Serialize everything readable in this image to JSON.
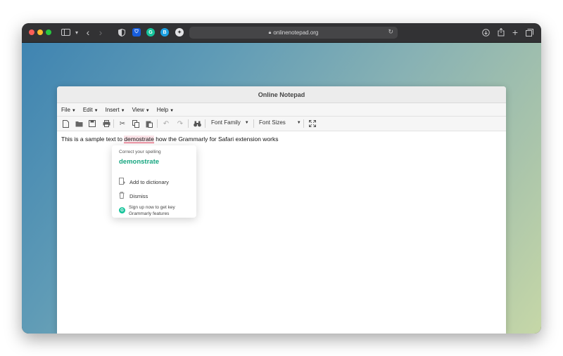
{
  "browser": {
    "url": "onlinenotepad.org"
  },
  "notepad": {
    "title": "Online Notepad",
    "menu": [
      {
        "label": "File"
      },
      {
        "label": "Edit"
      },
      {
        "label": "Insert"
      },
      {
        "label": "View"
      },
      {
        "label": "Help"
      }
    ],
    "toolbar": {
      "font_family": "Font Family",
      "font_sizes": "Font Sizes"
    },
    "text_before": "This is a sample text to ",
    "misspelled_word": "demostrate",
    "text_after": " how the Grammarly for Safari extension works"
  },
  "grammarly_popup": {
    "hint": "Correct your spelling",
    "suggestion": "demonstrate",
    "add_to_dictionary": "Add to dictionary",
    "dismiss": "Dismiss",
    "signup_line1": "Sign up now to get key",
    "signup_line2": "Grammarly features"
  },
  "colors": {
    "grammarly_green": "#15c39a",
    "suggestion_green": "#15a57f",
    "misspelling_red": "#e3506a"
  }
}
